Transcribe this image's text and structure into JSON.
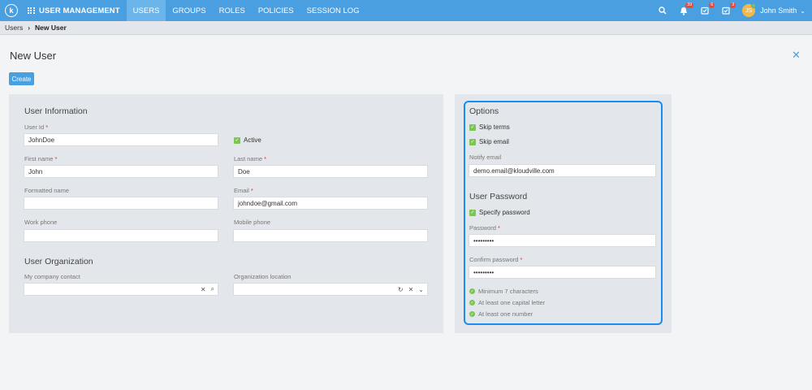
{
  "topbar": {
    "logo": "k",
    "app_title": "USER MANAGEMENT",
    "nav": [
      "USERS",
      "GROUPS",
      "ROLES",
      "POLICIES",
      "SESSION LOG"
    ],
    "active_nav": "USERS",
    "badges": {
      "notifications": "39",
      "tasks": "6",
      "approvals": "3"
    },
    "avatar_initials": "JS",
    "user_name": "John Smith"
  },
  "breadcrumb": {
    "parent": "Users",
    "current": "New User"
  },
  "page": {
    "title": "New User",
    "create_label": "Create"
  },
  "user_info": {
    "title": "User Information",
    "user_id_label": "User Id",
    "user_id_value": "JohnDoe",
    "active_label": "Active",
    "first_name_label": "First name",
    "first_name_value": "John",
    "last_name_label": "Last name",
    "last_name_value": "Doe",
    "formatted_name_label": "Formatted name",
    "formatted_name_value": "",
    "email_label": "Email",
    "email_value": "johndoe@gmail.com",
    "work_phone_label": "Work phone",
    "work_phone_value": "",
    "mobile_phone_label": "Mobile phone",
    "mobile_phone_value": ""
  },
  "user_org": {
    "title": "User Organization",
    "contact_label": "My company contact",
    "contact_value": "",
    "location_label": "Organization location",
    "location_value": ""
  },
  "options": {
    "title": "Options",
    "skip_terms": "Skip terms",
    "skip_email": "Skip email",
    "notify_email_label": "Notify email",
    "notify_email_value": "demo.email@kloudville.com"
  },
  "password": {
    "title": "User Password",
    "specify_label": "Specify password",
    "password_label": "Password",
    "password_value": "•••••••••",
    "confirm_label": "Confirm password",
    "confirm_value": "•••••••••",
    "rules": [
      "Minimum 7 characters",
      "At least one capital letter",
      "At least one number"
    ]
  },
  "colors": {
    "accent": "#4a9fe0",
    "success": "#7ac74f",
    "highlight": "#1a8cf0"
  }
}
